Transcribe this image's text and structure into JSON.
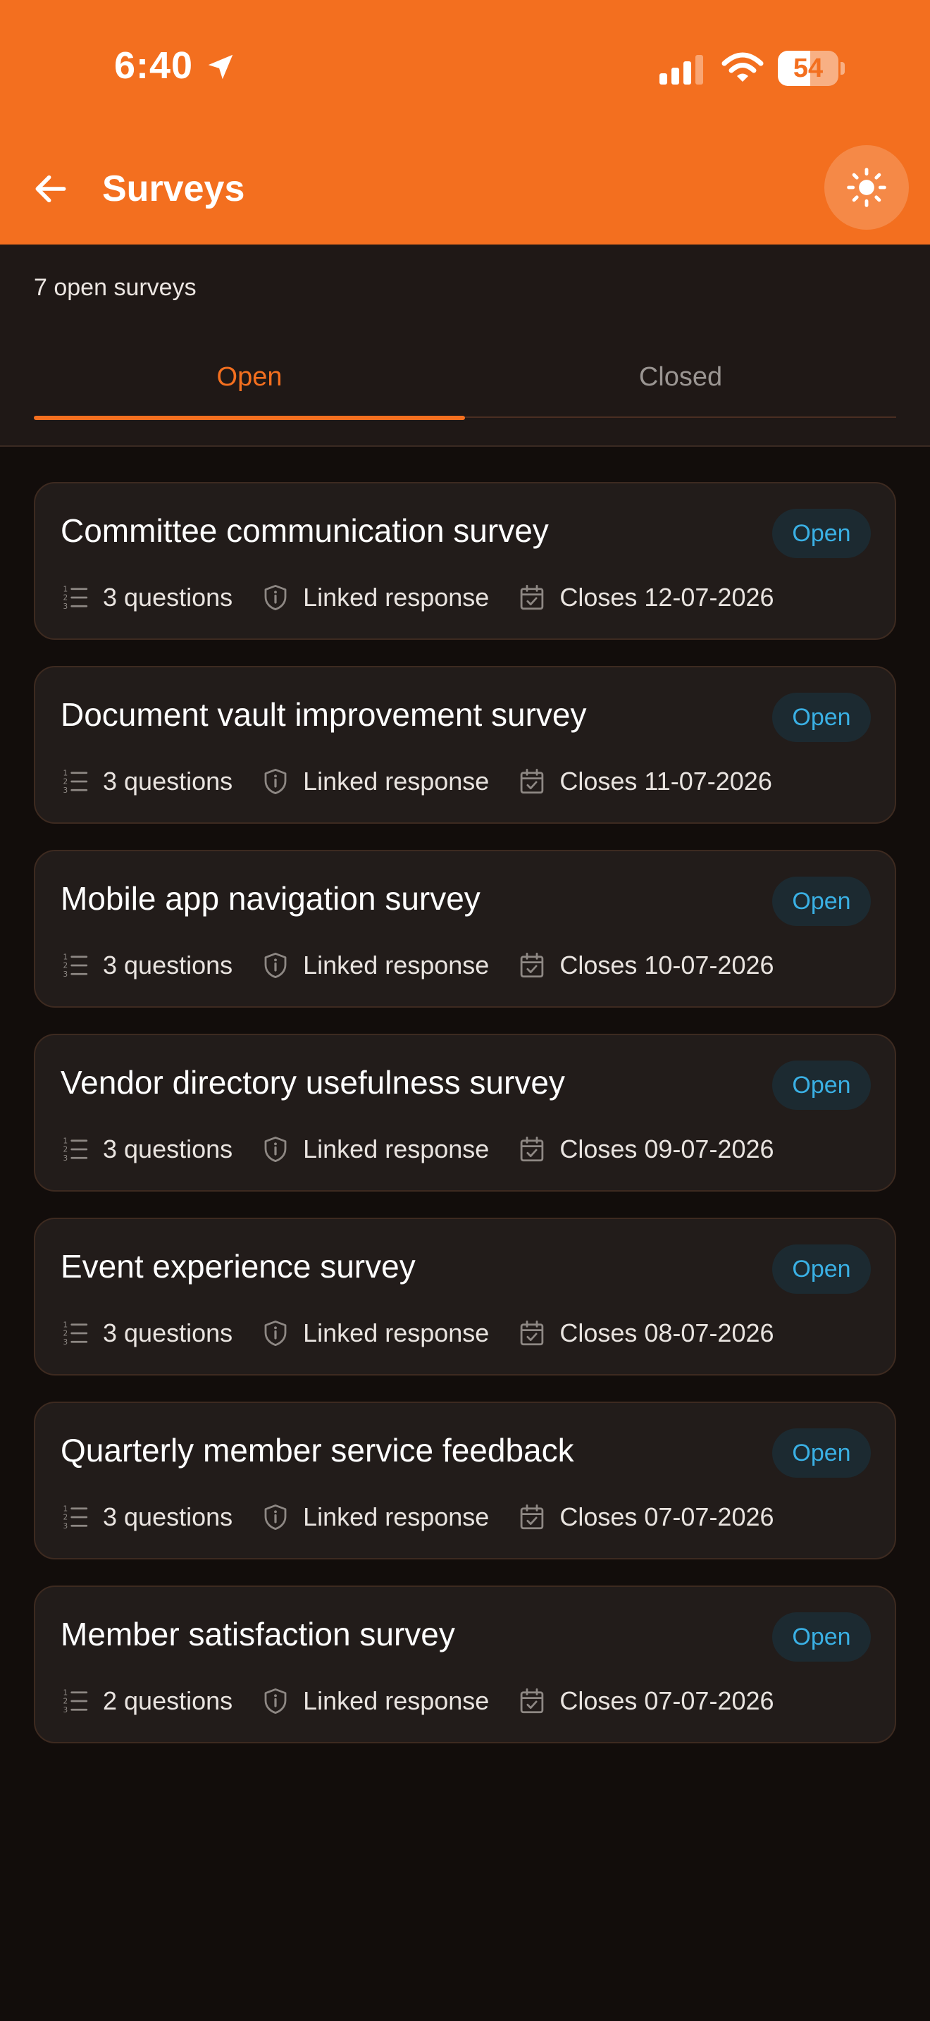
{
  "status_bar": {
    "time": "6:40",
    "battery_percent": 54,
    "battery_label": "54"
  },
  "header": {
    "title": "Surveys"
  },
  "summary": "7 open surveys",
  "tabs": [
    {
      "label": "Open",
      "active": true
    },
    {
      "label": "Closed",
      "active": false
    }
  ],
  "colors": {
    "accent": "#f36f1f",
    "badge_text": "#3ab0e4",
    "background": "#120d0b",
    "card": "#221c1a"
  },
  "surveys": [
    {
      "title": "Committee communication survey",
      "status": "Open",
      "questions": "3 questions",
      "response": "Linked response",
      "closes": "Closes 12-07-2026"
    },
    {
      "title": "Document vault improvement survey",
      "status": "Open",
      "questions": "3 questions",
      "response": "Linked response",
      "closes": "Closes 11-07-2026"
    },
    {
      "title": "Mobile app navigation survey",
      "status": "Open",
      "questions": "3 questions",
      "response": "Linked response",
      "closes": "Closes 10-07-2026"
    },
    {
      "title": "Vendor directory usefulness survey",
      "status": "Open",
      "questions": "3 questions",
      "response": "Linked response",
      "closes": "Closes 09-07-2026"
    },
    {
      "title": "Event experience survey",
      "status": "Open",
      "questions": "3 questions",
      "response": "Linked response",
      "closes": "Closes 08-07-2026"
    },
    {
      "title": "Quarterly member service feedback",
      "status": "Open",
      "questions": "3 questions",
      "response": "Linked response",
      "closes": "Closes 07-07-2026"
    },
    {
      "title": "Member satisfaction survey",
      "status": "Open",
      "questions": "2 questions",
      "response": "Linked response",
      "closes": "Closes 07-07-2026"
    }
  ]
}
